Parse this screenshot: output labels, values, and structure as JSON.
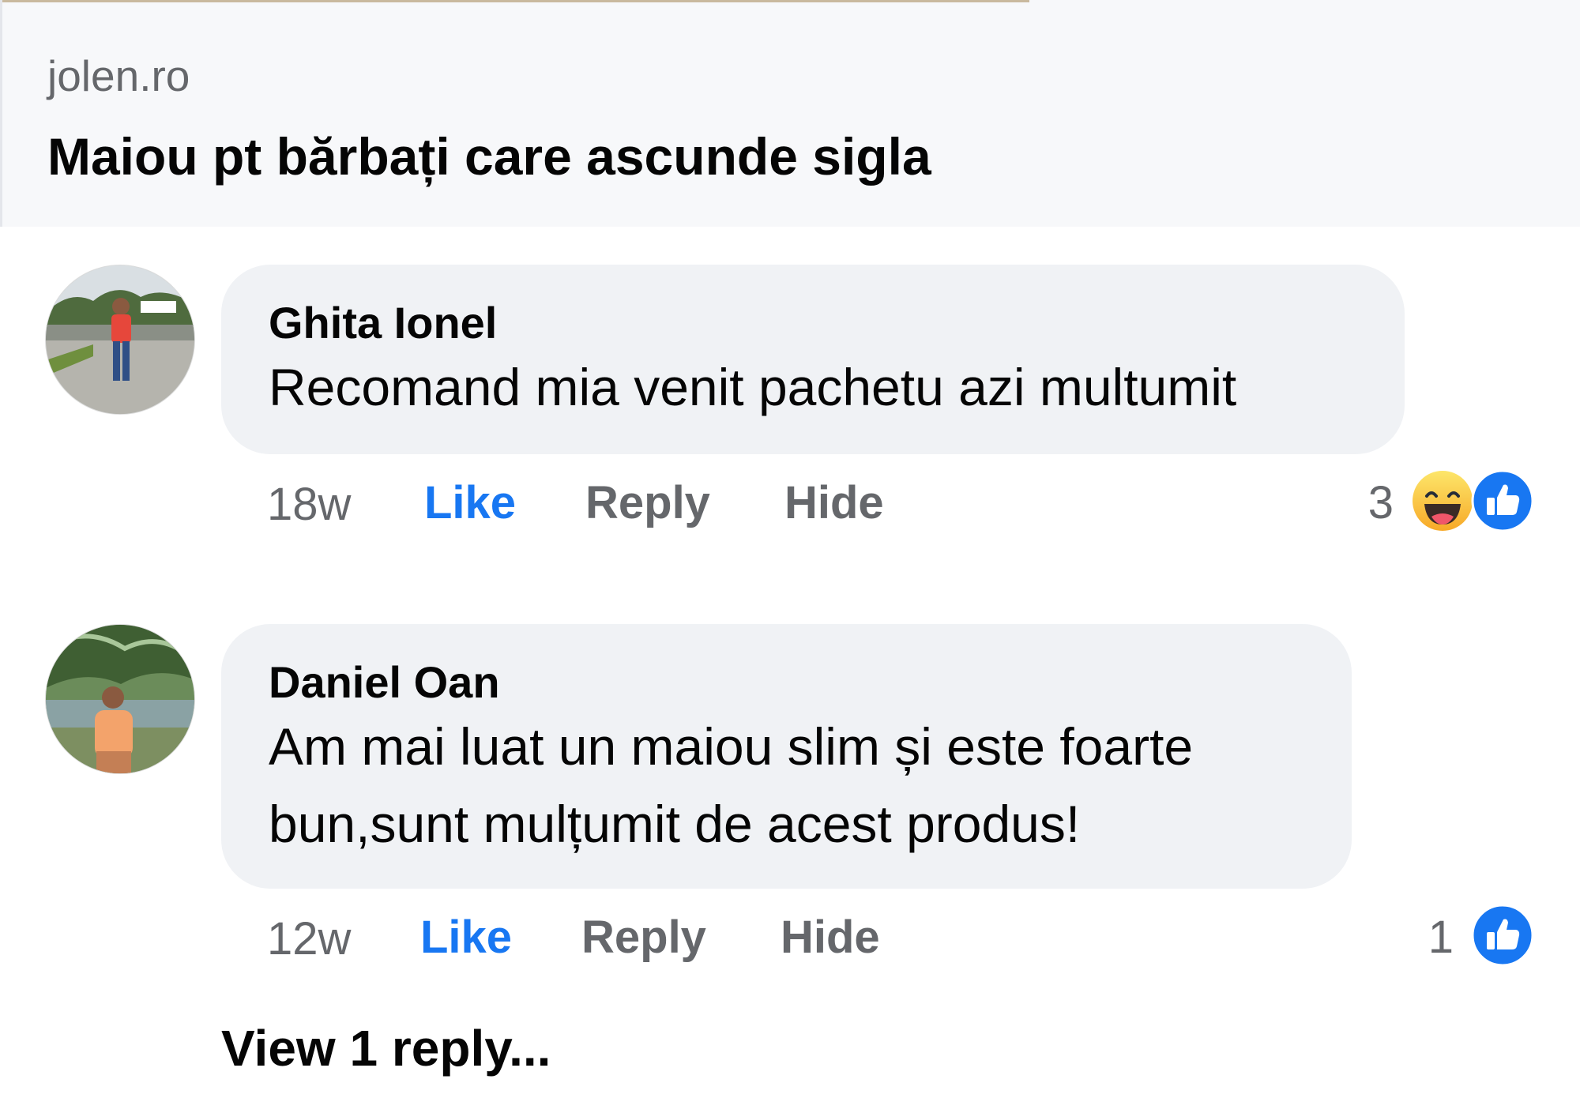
{
  "link_preview": {
    "domain": "jolen.ro",
    "title": "Maiou pt bărbați care ascunde sigla"
  },
  "comments": [
    {
      "author": "Ghita Ionel",
      "lines": [
        "Recomand mia venit pachetu azi multumit"
      ],
      "time": "18w",
      "like_label": "Like",
      "reply_label": "Reply",
      "hide_label": "Hide",
      "reaction_count": "3",
      "reactions": [
        "haha-icon",
        "like-icon"
      ]
    },
    {
      "author": "Daniel Oan",
      "lines": [
        "Am mai luat un maiou slim și este foarte",
        "bun,sunt mulțumit de acest produs!"
      ],
      "time": "12w",
      "like_label": "Like",
      "reply_label": "Reply",
      "hide_label": "Hide",
      "reaction_count": "1",
      "reactions": [
        "like-icon"
      ]
    }
  ],
  "view_replies_label": "View 1 reply...",
  "colors": {
    "accent": "#1877f2",
    "bubble": "#f0f2f5",
    "muted_text": "#65676b",
    "text": "#050505",
    "card_background": "#f7f8fa"
  }
}
